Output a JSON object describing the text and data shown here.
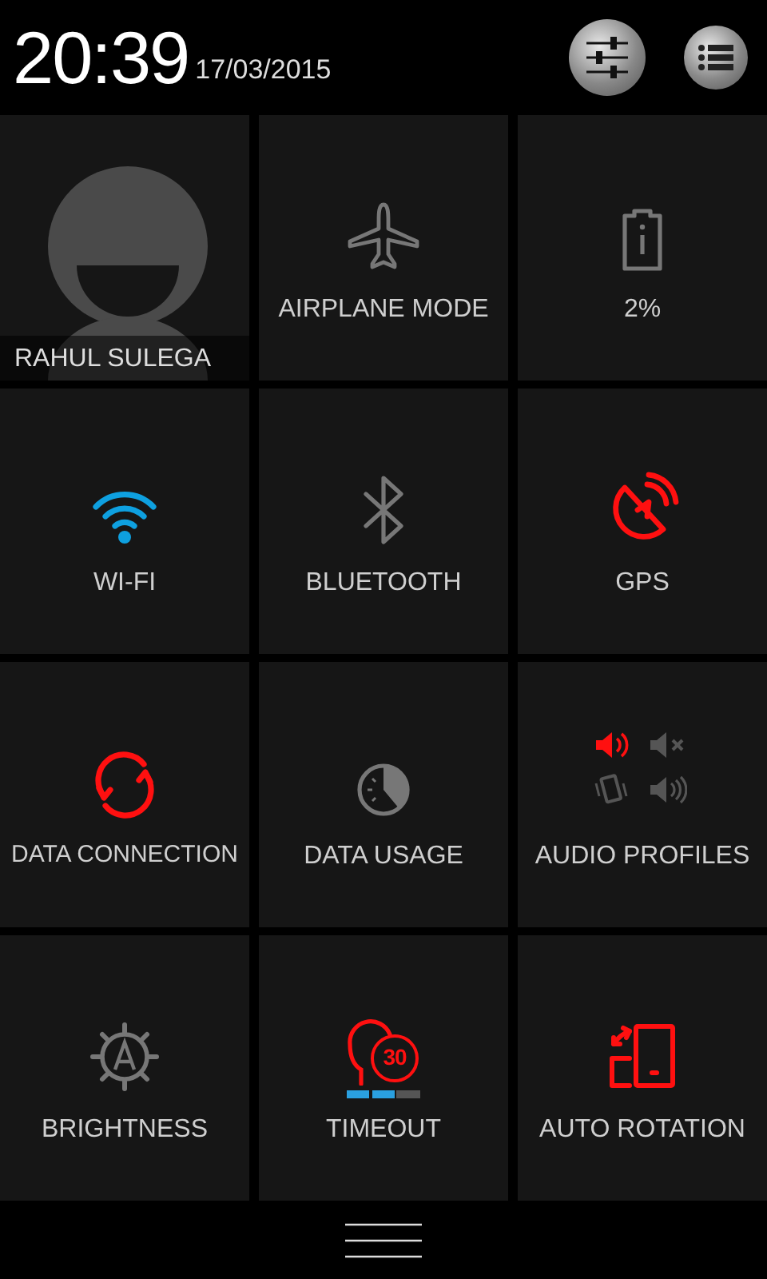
{
  "header": {
    "time": "20:39",
    "date": "17/03/2015",
    "buttons": [
      {
        "kind": "sliders"
      },
      {
        "kind": "list"
      }
    ]
  },
  "tiles": [
    {
      "kind": "profile",
      "label": "RAHUL SULEGA"
    },
    {
      "kind": "airplane",
      "label": "AIRPLANE MODE",
      "on": false
    },
    {
      "kind": "battery",
      "label": "2%",
      "on": false
    },
    {
      "kind": "wifi",
      "label": "WI-FI",
      "on": true
    },
    {
      "kind": "bluetooth",
      "label": "BLUETOOTH",
      "on": false
    },
    {
      "kind": "gps",
      "label": "GPS",
      "on": true
    },
    {
      "kind": "data",
      "label": "DATA CONNECTION",
      "on": true
    },
    {
      "kind": "usage",
      "label": "DATA USAGE",
      "on": false
    },
    {
      "kind": "audio",
      "label": "AUDIO PROFILES",
      "profiles": [
        {
          "kind": "loud",
          "selected": true
        },
        {
          "kind": "mute",
          "selected": false
        },
        {
          "kind": "vibrate",
          "selected": false
        },
        {
          "kind": "normal",
          "selected": false
        }
      ]
    },
    {
      "kind": "brightness",
      "label": "BRIGHTNESS",
      "on": false
    },
    {
      "kind": "timeout",
      "label": "TIMEOUT",
      "on": true,
      "value": "30",
      "level": 0.67
    },
    {
      "kind": "rotation",
      "label": "AUTO ROTATION",
      "on": true
    }
  ]
}
